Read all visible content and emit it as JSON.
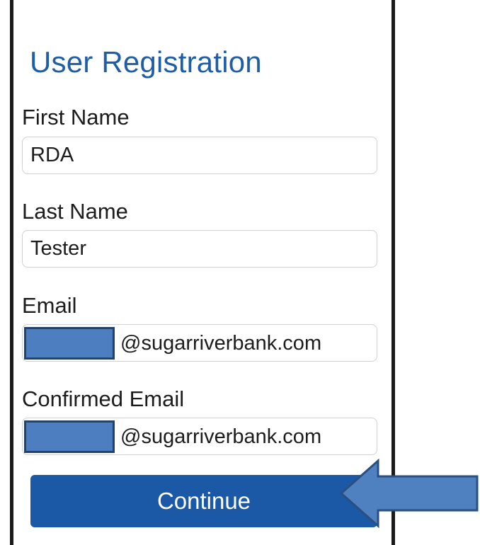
{
  "form": {
    "title": "User Registration",
    "first_name": {
      "label": "First Name",
      "value": "RDA"
    },
    "last_name": {
      "label": "Last Name",
      "value": "Tester"
    },
    "email": {
      "label": "Email",
      "value_domain": "@sugarriverbank.com"
    },
    "confirmed_email": {
      "label": "Confirmed Email",
      "value_domain": "@sugarriverbank.com"
    },
    "continue_label": "Continue"
  },
  "colors": {
    "accent": "#1b58a5",
    "title": "#1e5ea8",
    "redaction": "#4d7fc0",
    "arrow": "#4f80c0"
  },
  "icons": {
    "pointer": "arrow-left-icon"
  }
}
